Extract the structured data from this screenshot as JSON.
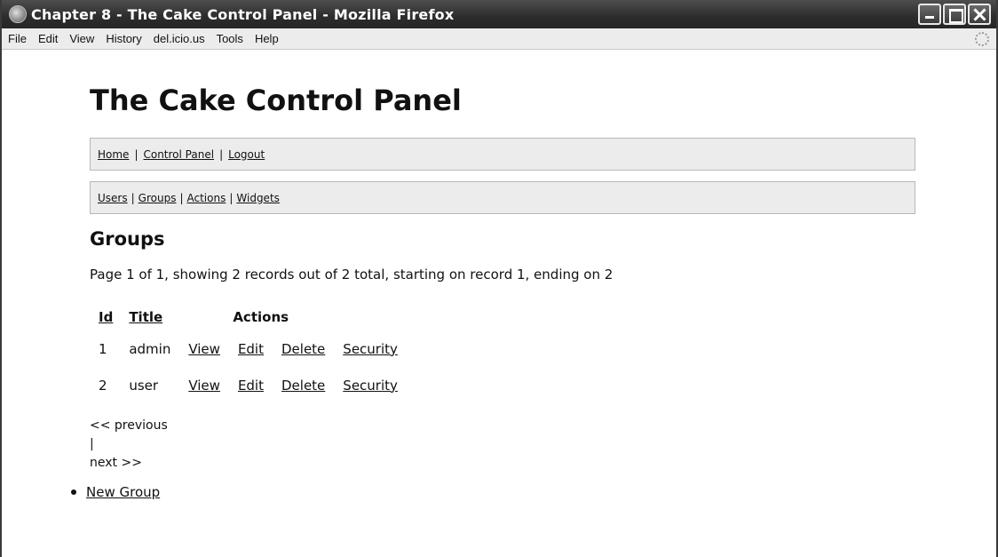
{
  "window": {
    "title": "Chapter 8 - The Cake Control Panel - Mozilla Firefox"
  },
  "menubar": {
    "items": [
      "File",
      "Edit",
      "View",
      "History",
      "del.icio.us",
      "Tools",
      "Help"
    ]
  },
  "page": {
    "title": "The Cake Control Panel",
    "nav_primary": {
      "home": "Home",
      "control_panel": "Control Panel",
      "logout": "Logout",
      "separator": "|"
    },
    "nav_secondary": {
      "users": "Users",
      "groups": "Groups",
      "actions": "Actions",
      "widgets": "Widgets",
      "separator": "|"
    },
    "section_title": "Groups",
    "summary": "Page 1 of 1, showing 2 records out of 2 total, starting on record 1, ending on 2",
    "table": {
      "headers": {
        "id": "Id",
        "title": "Title",
        "actions": "Actions"
      },
      "rows": [
        {
          "id": "1",
          "title": "admin",
          "view": "View",
          "edit": "Edit",
          "delete": "Delete",
          "security": "Security"
        },
        {
          "id": "2",
          "title": "user",
          "view": "View",
          "edit": "Edit",
          "delete": "Delete",
          "security": "Security"
        }
      ]
    },
    "pager": {
      "previous": "<< previous",
      "separator": "|",
      "next": "next >>"
    },
    "new_group_link": "New Group"
  }
}
